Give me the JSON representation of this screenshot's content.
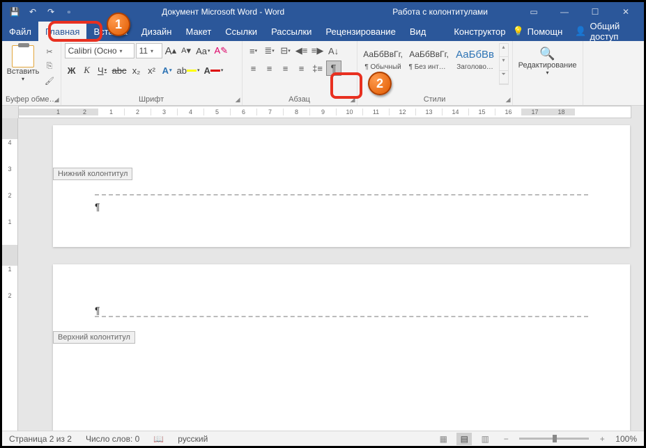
{
  "title": "Документ Microsoft Word - Word",
  "contextTitle": "Работа с колонтитулами",
  "tabs": {
    "file": "Файл",
    "home": "Главная",
    "insert": "Вставка",
    "design": "Дизайн",
    "layout": "Макет",
    "references": "Ссылки",
    "mailings": "Рассылки",
    "review": "Рецензирование",
    "view": "Вид",
    "constructor": "Конструктор",
    "help": "Помощн",
    "share": "Общий доступ"
  },
  "ribbon": {
    "clipboard": {
      "paste": "Вставить",
      "label": "Буфер обме…"
    },
    "font": {
      "name": "Calibri (Осно",
      "size": "11",
      "label": "Шрифт",
      "bold": "Ж",
      "italic": "К",
      "underline": "Ч",
      "strike": "abc",
      "sub": "x₂",
      "super": "x²",
      "grow": "A",
      "shrink": "A",
      "case": "Aa",
      "clear": "✎"
    },
    "paragraph": {
      "label": "Абзац",
      "pilcrow": "¶"
    },
    "styles": {
      "label": "Стили",
      "items": [
        {
          "preview": "АаБбВвГг,",
          "name": "¶ Обычный",
          "color": "#333"
        },
        {
          "preview": "АаБбВвГг,",
          "name": "¶ Без инте…",
          "color": "#333"
        },
        {
          "preview": "АаБбВв",
          "name": "Заголово…",
          "color": "#2e74b5"
        }
      ]
    },
    "editing": {
      "label": "Редактирование"
    }
  },
  "document": {
    "footerLabel": "Нижний колонтитул",
    "headerLabel": "Верхний колонтитул",
    "pilcrow": "¶"
  },
  "statusbar": {
    "page": "Страница 2 из 2",
    "words": "Число слов: 0",
    "lang": "русский",
    "zoom": "100%"
  },
  "callouts": {
    "c1": "1",
    "c2": "2"
  }
}
